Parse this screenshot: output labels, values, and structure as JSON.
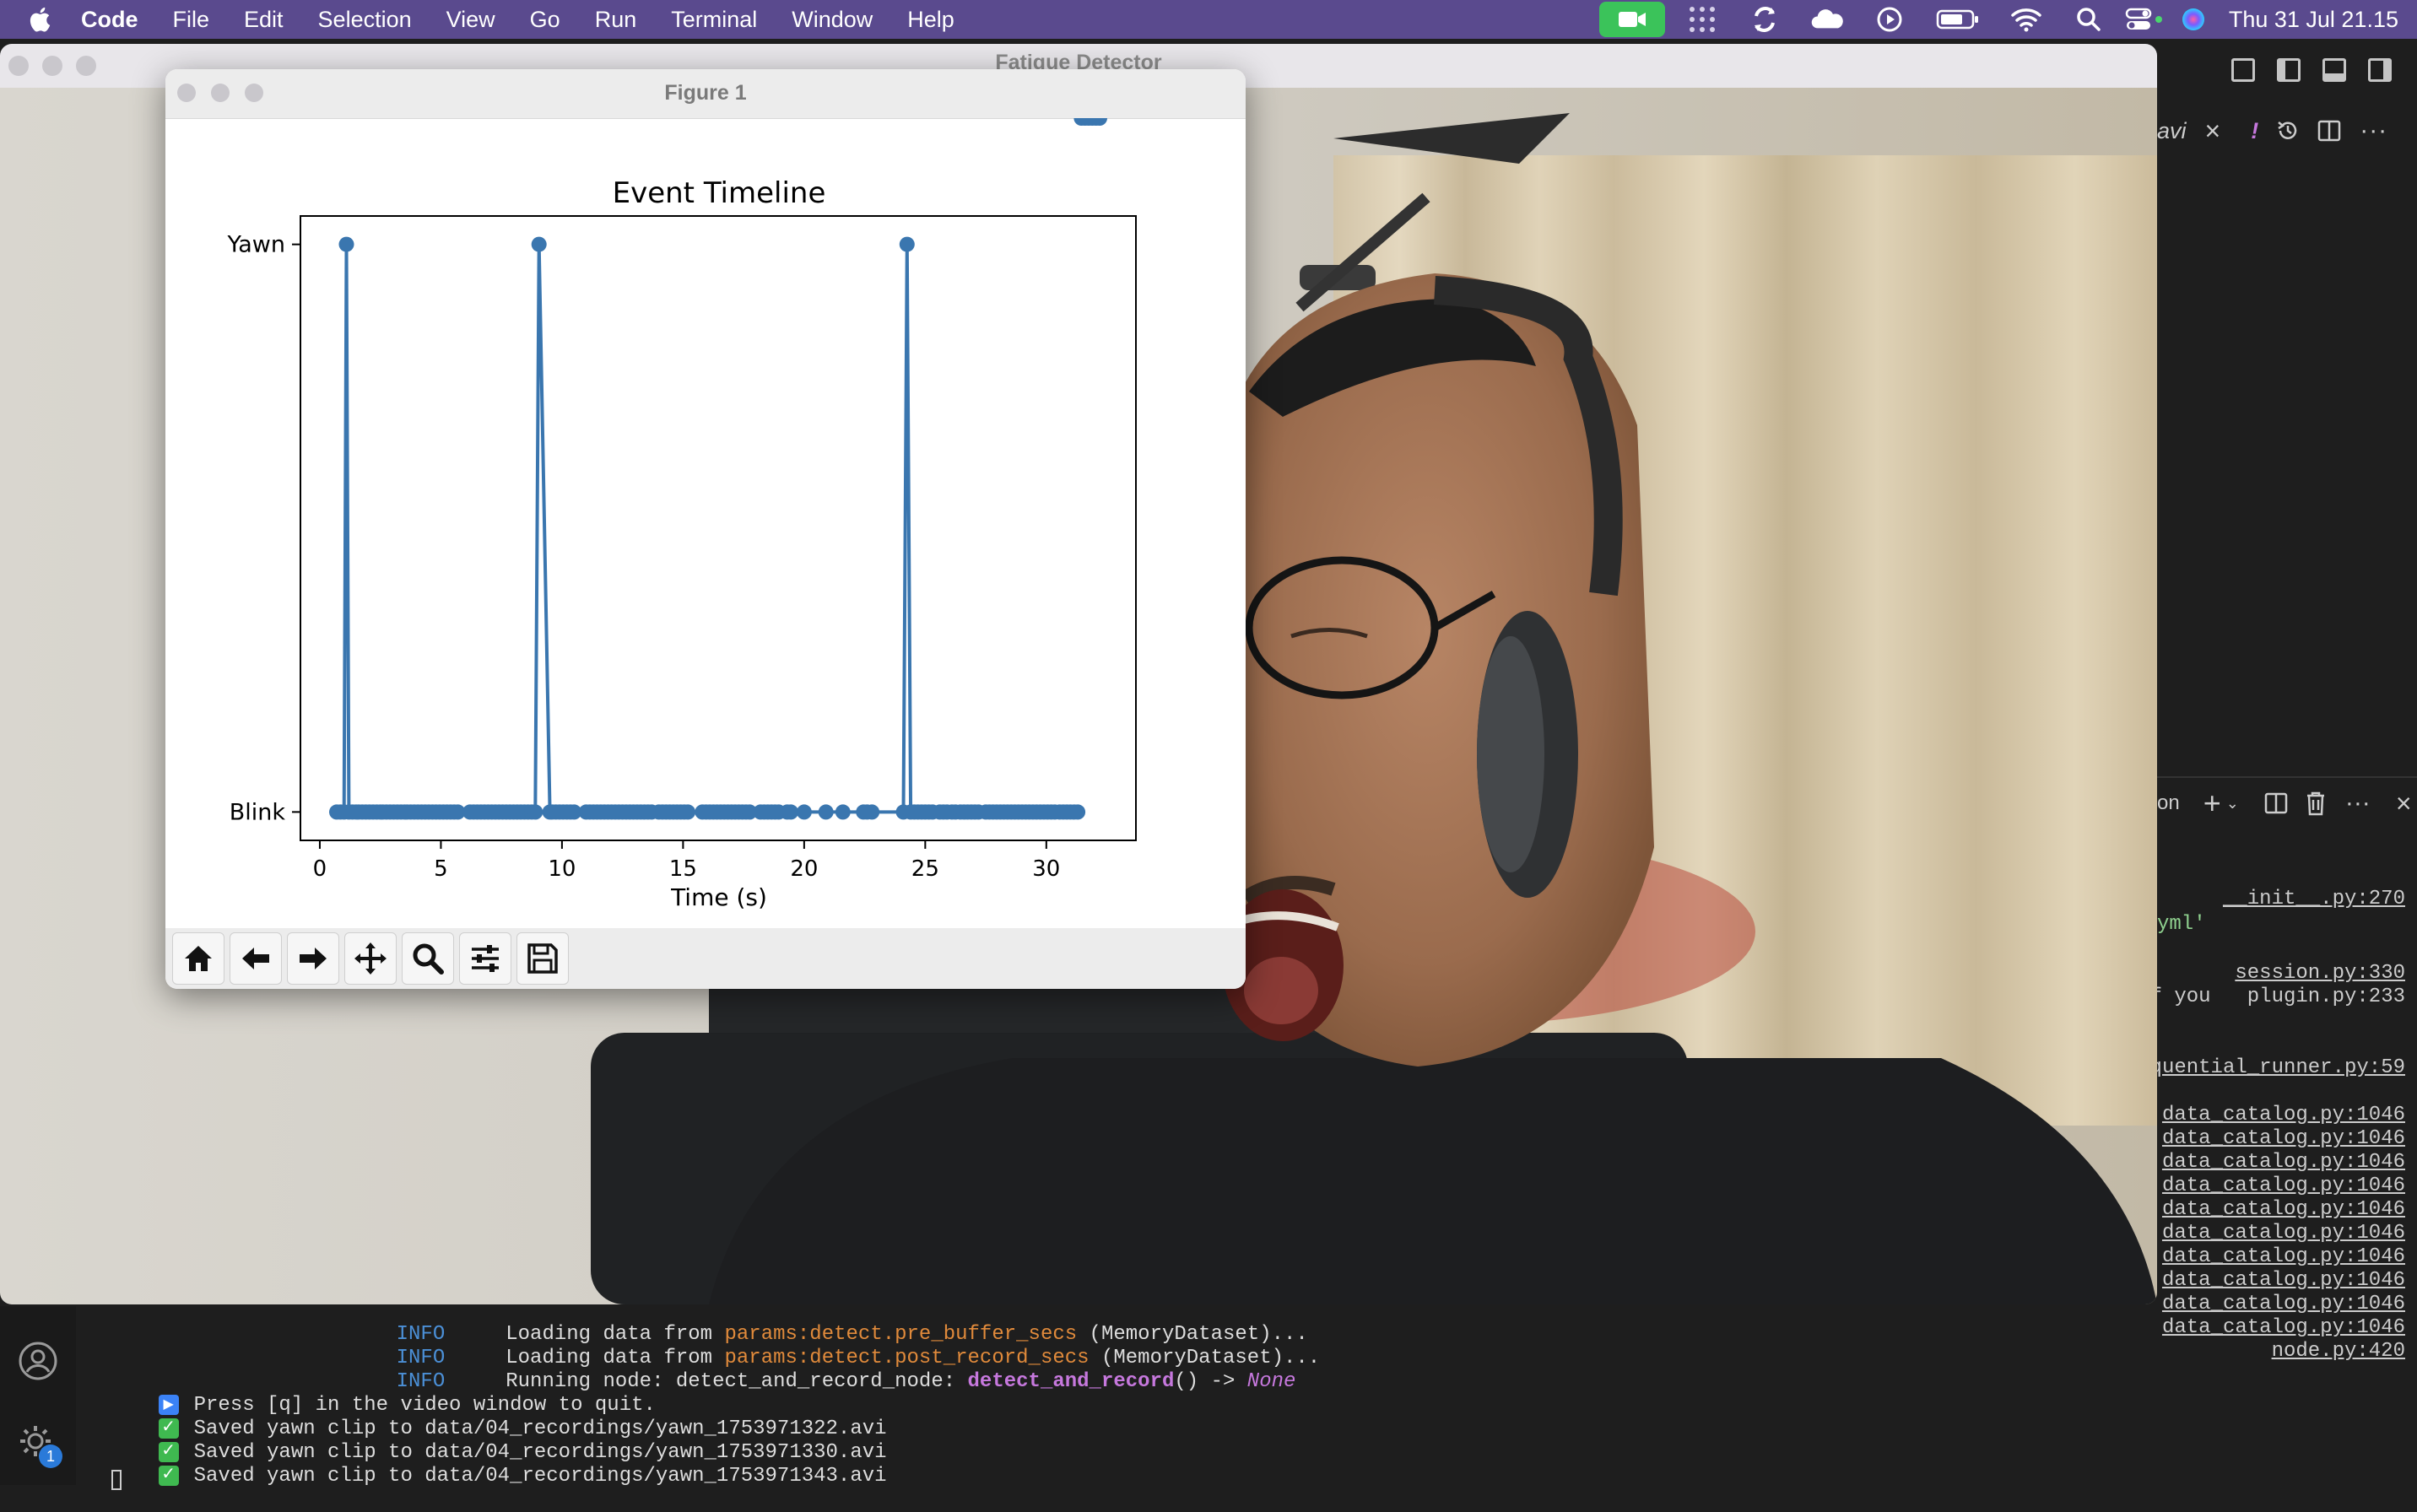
{
  "menubar": {
    "app_name": "Code",
    "items": [
      "File",
      "Edit",
      "Selection",
      "View",
      "Go",
      "Run",
      "Terminal",
      "Window",
      "Help"
    ],
    "clock": "Thu 31 Jul  21.15"
  },
  "video_window": {
    "title": "Fatigue Detector"
  },
  "figure_window": {
    "title": "Figure 1"
  },
  "vscode": {
    "tab_fragment": "avi",
    "terminal_tab_fragment": "on",
    "right_lines": [
      {
        "text": "__init__.py:270",
        "color": "#ccc",
        "underline": true,
        "align": "right"
      },
      {
        "text": "yml'",
        "color": "#8fd18f",
        "underline": false,
        "align": "left"
      },
      {
        "text": "session.py:330",
        "color": "#ccc",
        "underline": true,
        "align": "right"
      },
      {
        "text": "f you   plugin.py:233",
        "color": "#ccc",
        "underline": false,
        "align": "mixed"
      },
      {
        "text": "quential_runner.py:59",
        "color": "#ccc",
        "underline": true,
        "align": "right"
      },
      {
        "text": "data_catalog.py:1046",
        "color": "#ccc",
        "underline": true,
        "align": "right"
      },
      {
        "text": "data_catalog.py:1046",
        "color": "#ccc",
        "underline": true,
        "align": "right"
      },
      {
        "text": "data_catalog.py:1046",
        "color": "#ccc",
        "underline": true,
        "align": "right"
      },
      {
        "text": "data_catalog.py:1046",
        "color": "#ccc",
        "underline": true,
        "align": "right"
      },
      {
        "text": "data_catalog.py:1046",
        "color": "#ccc",
        "underline": true,
        "align": "right"
      },
      {
        "text": "data_catalog.py:1046",
        "color": "#ccc",
        "underline": true,
        "align": "right"
      },
      {
        "text": "data_catalog.py:1046",
        "color": "#ccc",
        "underline": true,
        "align": "right"
      },
      {
        "text": "data_catalog.py:1046",
        "color": "#ccc",
        "underline": true,
        "align": "right"
      },
      {
        "text": "data_catalog.py:1046",
        "color": "#ccc",
        "underline": true,
        "align": "right"
      },
      {
        "text": "data_catalog.py:1046",
        "color": "#ccc",
        "underline": true,
        "align": "right"
      },
      {
        "text": "node.py:420",
        "color": "#ccc",
        "underline": true,
        "align": "right"
      }
    ],
    "badge_count": "1"
  },
  "terminal": {
    "line0": {
      "level": "INFO",
      "text_a": "Loading data from ",
      "param": "params:detect.pre_buffer_secs",
      "text_b": " (MemoryDataset)..."
    },
    "line1": {
      "level": "INFO",
      "text_a": "Loading data from ",
      "param": "params:detect.post_record_secs",
      "text_b": " (MemoryDataset)..."
    },
    "line2": {
      "level": "INFO",
      "text_a": "Running node: detect_and_record_node: ",
      "fn": "detect_and_record",
      "text_b": "() -> ",
      "ret": "None"
    },
    "line3": "Press [q] in the video window to quit.",
    "saved": [
      "Saved yawn clip to data/04_recordings/yawn_1753971322.avi",
      "Saved yawn clip to data/04_recordings/yawn_1753971330.avi",
      "Saved yawn clip to data/04_recordings/yawn_1753971343.avi"
    ]
  },
  "chart_data": {
    "type": "line",
    "title": "Event Timeline",
    "xlabel": "Time (s)",
    "ylabel": "",
    "xlim": [
      -0.8,
      33.7
    ],
    "xticks": [
      0,
      5,
      10,
      15,
      20,
      25,
      30
    ],
    "ylim": [
      -0.05,
      1.05
    ],
    "ytick_labels": [
      "Blink",
      "Yawn"
    ],
    "grid": false,
    "series_color": "#3a76af",
    "x": [
      0.7,
      0.85,
      1.0,
      1.1,
      1.2,
      1.35,
      1.5,
      1.6,
      1.75,
      1.9,
      2.05,
      2.2,
      2.35,
      2.5,
      2.6,
      2.75,
      2.9,
      3.05,
      3.2,
      3.35,
      3.5,
      3.6,
      3.75,
      3.9,
      4.05,
      4.2,
      4.35,
      4.5,
      4.65,
      4.8,
      4.95,
      5.1,
      5.25,
      5.4,
      5.55,
      5.7,
      6.2,
      6.35,
      6.5,
      6.65,
      6.8,
      6.95,
      7.1,
      7.25,
      7.4,
      7.55,
      7.7,
      7.85,
      8.0,
      8.15,
      8.3,
      8.45,
      8.6,
      8.75,
      8.9,
      9.05,
      9.5,
      9.6,
      9.75,
      9.9,
      10.05,
      10.2,
      10.35,
      10.5,
      11.0,
      11.15,
      11.3,
      11.45,
      11.6,
      11.75,
      11.9,
      12.05,
      12.2,
      12.35,
      12.5,
      12.65,
      12.8,
      12.95,
      13.1,
      13.25,
      13.4,
      13.55,
      13.7,
      14.0,
      14.15,
      14.3,
      14.45,
      14.6,
      14.75,
      14.9,
      15.05,
      15.2,
      15.8,
      15.95,
      16.1,
      16.25,
      16.4,
      16.55,
      16.7,
      16.85,
      17.0,
      17.15,
      17.3,
      17.45,
      17.6,
      17.75,
      18.2,
      18.35,
      18.5,
      18.65,
      18.8,
      18.95,
      19.3,
      19.45,
      20.0,
      20.9,
      21.6,
      22.45,
      22.6,
      22.8,
      24.1,
      24.25,
      24.4,
      24.55,
      24.7,
      24.85,
      25.0,
      25.15,
      25.3,
      25.6,
      25.75,
      25.9,
      26.1,
      26.25,
      26.45,
      26.6,
      26.75,
      26.9,
      27.05,
      27.2,
      27.5,
      27.65,
      27.8,
      27.95,
      28.1,
      28.25,
      28.4,
      28.55,
      28.7,
      28.85,
      29.0,
      29.15,
      29.3,
      29.45,
      29.6,
      29.75,
      29.9,
      30.05,
      30.2,
      30.35,
      30.55,
      30.7,
      30.85,
      31.0,
      31.15,
      31.3,
      31.45,
      31.6,
      31.75,
      31.9,
      32.05,
      32.2
    ],
    "y": [
      0,
      0,
      0,
      1,
      0,
      0,
      0,
      0,
      0,
      0,
      0,
      0,
      0,
      0,
      0,
      0,
      0,
      0,
      0,
      0,
      0,
      0,
      0,
      0,
      0,
      0,
      0,
      0,
      0,
      0,
      0,
      0,
      0,
      0,
      0,
      0,
      0,
      0,
      0,
      0,
      0,
      0,
      0,
      0,
      0,
      0,
      0,
      0,
      0,
      0,
      0,
      0,
      0,
      0,
      0,
      1,
      0,
      0,
      0,
      0,
      0,
      0,
      0,
      0,
      0,
      0,
      0,
      0,
      0,
      0,
      0,
      0,
      0,
      0,
      0,
      0,
      0,
      0,
      0,
      0,
      0,
      0,
      0,
      0,
      0,
      0,
      0,
      0,
      0,
      0,
      0,
      0,
      0,
      0,
      0,
      0,
      0,
      0,
      0,
      0,
      0,
      0,
      0,
      0,
      0,
      0,
      0,
      0,
      0,
      0,
      0,
      0,
      0,
      0,
      0,
      0,
      0,
      0,
      0,
      0,
      0,
      1,
      0,
      0,
      0,
      0,
      0,
      0,
      0,
      0,
      0,
      0,
      0,
      0,
      0,
      0,
      0,
      0,
      0,
      0,
      0,
      0,
      0,
      0,
      0,
      0,
      0,
      0,
      0,
      0,
      0,
      0,
      0,
      0,
      0,
      0,
      0,
      0,
      0,
      0,
      0,
      0,
      0,
      0,
      0,
      0
    ]
  }
}
